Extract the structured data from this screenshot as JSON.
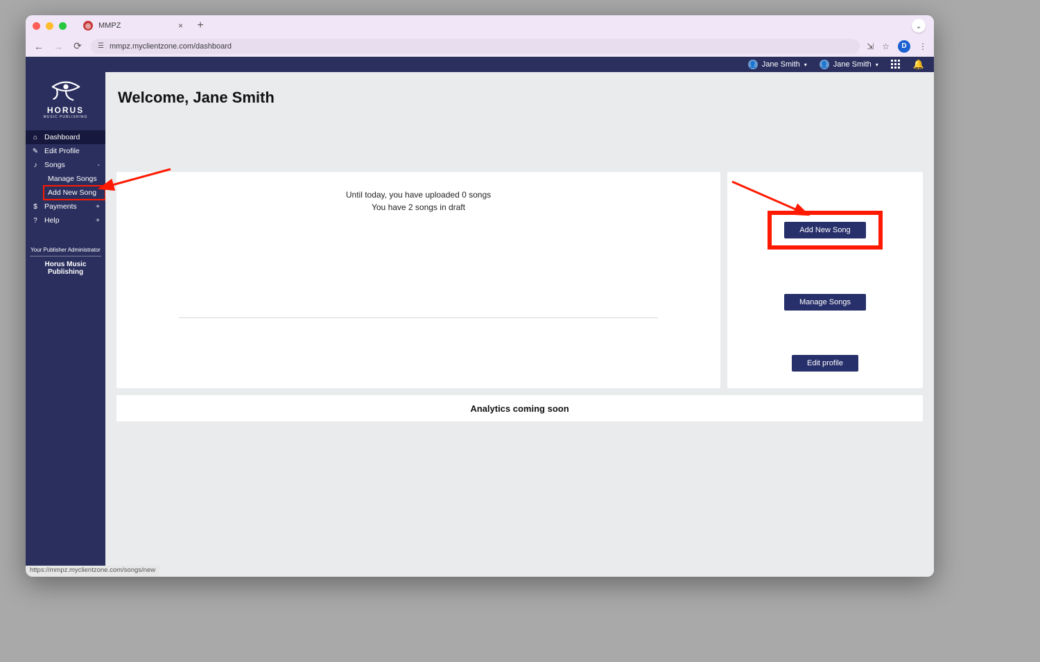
{
  "browser": {
    "tab_title": "MMPZ",
    "url": "mmpz.myclientzone.com/dashboard",
    "avatar_initial": "D",
    "status_url": "https://mmpz.myclientzone.com/songs/new"
  },
  "topbar": {
    "user1": "Jane Smith",
    "user2": "Jane Smith"
  },
  "logo": {
    "brand": "HORUS",
    "sub": "MUSIC PUBLISHING"
  },
  "nav": {
    "dashboard": "Dashboard",
    "edit_profile": "Edit Profile",
    "songs": "Songs",
    "songs_expander": "-",
    "manage_songs": "Manage Songs",
    "add_new_song": "Add New Song",
    "payments": "Payments",
    "payments_expander": "+",
    "help": "Help",
    "help_expander": "+"
  },
  "admin": {
    "label": "Your Publisher Administrator",
    "name": "Horus Music Publishing"
  },
  "main": {
    "welcome": "Welcome, Jane Smith",
    "stats_line1": "Until today, you have uploaded 0 songs",
    "stats_line2": "You have 2 songs in draft",
    "buttons": {
      "add_new_song": "Add New Song",
      "manage_songs": "Manage Songs",
      "edit_profile": "Edit profile"
    },
    "analytics": "Analytics coming soon"
  }
}
